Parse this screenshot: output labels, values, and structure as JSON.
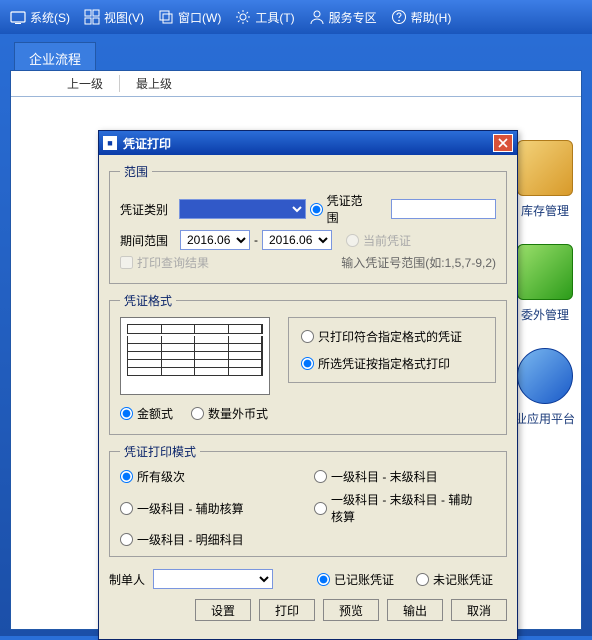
{
  "menu": {
    "system": "系统(S)",
    "view": "视图(V)",
    "window": "窗口(W)",
    "tools": "工具(T)",
    "service": "服务专区",
    "help": "帮助(H)"
  },
  "tab": {
    "main": "企业流程"
  },
  "breadcrumb": {
    "up": "上一级",
    "top": "最上级"
  },
  "bg": {
    "inventory": "库存管理",
    "outside": "委外管理",
    "app": "业应用平台"
  },
  "dialog": {
    "title": "凭证打印",
    "scope": {
      "legend": "范围",
      "category_label": "凭证类别",
      "range_radio": "凭证范围",
      "period_label": "期间范围",
      "period_from": "2016.06",
      "period_to": "2016.06",
      "current_radio": "当前凭证",
      "print_query": "打印查询结果",
      "hint": "输入凭证号范围(如:1,5,7-9,2)"
    },
    "format": {
      "legend": "凭证格式",
      "only_match": "只打印符合指定格式的凭证",
      "by_format": "所选凭证按指定格式打印",
      "amount": "金额式",
      "qty_fx": "数量外币式"
    },
    "mode": {
      "legend": "凭证打印模式",
      "all_levels": "所有级次",
      "lvl1_leaf": "一级科目 - 末级科目",
      "lvl1_aux": "一级科目 - 辅助核算",
      "lvl1_leaf_aux": "一级科目 - 末级科目 - 辅助核算",
      "lvl1_detail": "一级科目 - 明细科目"
    },
    "footer": {
      "maker_label": "制单人",
      "posted": "已记账凭证",
      "unposted": "未记账凭证"
    },
    "buttons": {
      "settings": "设置",
      "print": "打印",
      "preview": "预览",
      "output": "输出",
      "cancel": "取消"
    }
  }
}
